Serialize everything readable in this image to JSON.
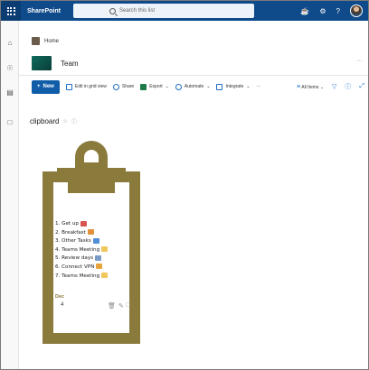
{
  "suite": {
    "brand": "SharePoint",
    "search_placeholder": "Search this list"
  },
  "breadcrumb": {
    "home": "Home"
  },
  "site": {
    "title": "Team",
    "more": "···"
  },
  "commands": {
    "new": "New",
    "edit_grid": "Edit in grid view",
    "share": "Share",
    "export": "Export",
    "automate": "Automate",
    "integrate": "Integrate",
    "more": "···",
    "view": "All Items"
  },
  "list": {
    "name": "clipboard"
  },
  "note": {
    "items": [
      "1. Get up",
      "2. Breakfast",
      "3. Other Tasks",
      "4. Teams Meeting",
      "5. Review days",
      "6. Connect VPN",
      "7. Teams Meeting"
    ],
    "month": "Dec",
    "day": "4"
  },
  "colors": {
    "suitebar": "#0f4a8a",
    "accent": "#0f5ca8",
    "clipboard": "#8a7a3c"
  },
  "icons": {
    "rail": [
      "home-icon",
      "globe-icon",
      "news-icon",
      "document-icon"
    ],
    "suite": [
      "megaphone-icon",
      "gear-icon",
      "help-icon"
    ]
  }
}
